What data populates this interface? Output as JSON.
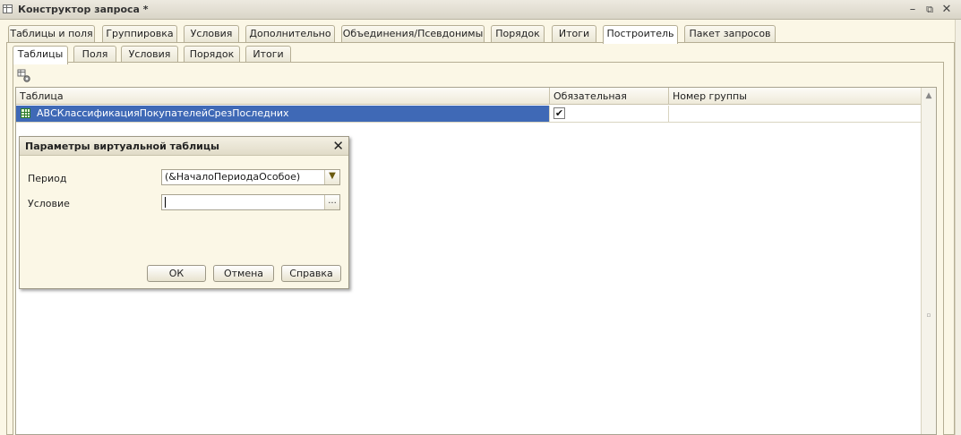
{
  "window": {
    "title": "Конструктор запроса *",
    "minimize": "–",
    "restore": "⧉",
    "close": "✕"
  },
  "top_tabs": [
    {
      "label": "Таблицы и поля"
    },
    {
      "label": "Группировка"
    },
    {
      "label": "Условия"
    },
    {
      "label": "Дополнительно"
    },
    {
      "label": "Объединения/Псевдонимы"
    },
    {
      "label": "Порядок"
    },
    {
      "label": "Итоги"
    },
    {
      "label": "Построитель"
    },
    {
      "label": "Пакет запросов"
    }
  ],
  "top_tabs_active": "Построитель",
  "sub_tabs": [
    {
      "label": "Таблицы"
    },
    {
      "label": "Поля"
    },
    {
      "label": "Условия"
    },
    {
      "label": "Порядок"
    },
    {
      "label": "Итоги"
    }
  ],
  "sub_tabs_active": "Таблицы",
  "toolbar": {
    "settings_icon": "table-settings-icon"
  },
  "grid": {
    "columns": [
      "Таблица",
      "Обязательная",
      "Номер группы"
    ],
    "rows": [
      {
        "table": "АВСКлассификацияПокупателейСрезПоследних",
        "required_mark": "✔",
        "required": true,
        "group_number": ""
      }
    ]
  },
  "dialog": {
    "title": "Параметры виртуальной таблицы",
    "close": "✕",
    "period_label": "Период",
    "period_value": "(&НачалоПериодаОсобое)",
    "condition_label": "Условие",
    "condition_value": "",
    "dropdown_glyph": "▼",
    "ellipsis_glyph": "...",
    "ok_label": "ОК",
    "cancel_label": "Отмена",
    "help_label": "Справка"
  },
  "colors": {
    "selection": "#3F69B6",
    "background": "#FBF7E6",
    "border": "#B5AE94"
  }
}
